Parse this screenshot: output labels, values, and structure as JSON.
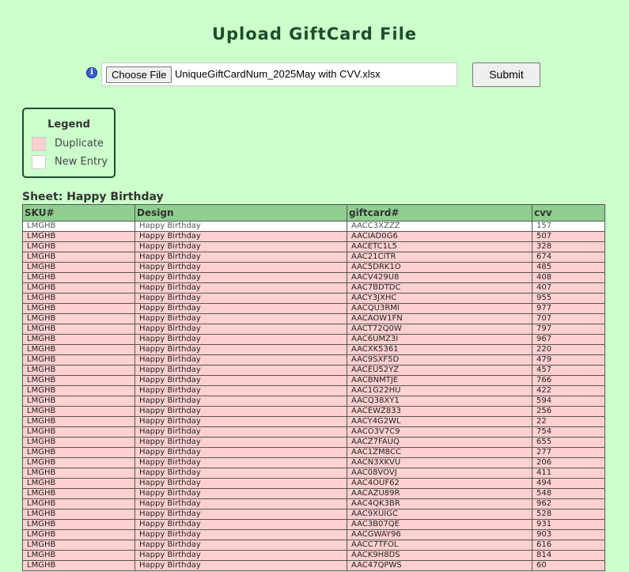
{
  "page": {
    "title": "Upload GiftCard File"
  },
  "upload": {
    "info_icon": "info-icon",
    "choose_label": "Choose File",
    "file_name": "UniqueGiftCardNum_2025May with CVV.xlsx",
    "submit_label": "Submit"
  },
  "legend": {
    "title": "Legend",
    "items": [
      {
        "label": "Duplicate",
        "color": "#ffd0d0"
      },
      {
        "label": "New Entry",
        "color": "#ffffff"
      }
    ]
  },
  "sheet": {
    "title": "Sheet: Happy Birthday",
    "columns": [
      "SKU#",
      "Design",
      "giftcard#",
      "cvv"
    ],
    "rows": [
      {
        "sku": "LMGHB",
        "design": "Happy Birthday",
        "giftcard": "AACC3XZZZ",
        "cvv": "157",
        "status": "new"
      },
      {
        "sku": "LMGHB",
        "design": "Happy Birthday",
        "giftcard": "AACIAD0G6",
        "cvv": "507",
        "status": "dup"
      },
      {
        "sku": "LMGHB",
        "design": "Happy Birthday",
        "giftcard": "AACETC1L5",
        "cvv": "328",
        "status": "dup"
      },
      {
        "sku": "LMGHB",
        "design": "Happy Birthday",
        "giftcard": "AAC21CITR",
        "cvv": "674",
        "status": "dup"
      },
      {
        "sku": "LMGHB",
        "design": "Happy Birthday",
        "giftcard": "AAC5DRK1O",
        "cvv": "485",
        "status": "dup"
      },
      {
        "sku": "LMGHB",
        "design": "Happy Birthday",
        "giftcard": "AACV429U8",
        "cvv": "408",
        "status": "dup"
      },
      {
        "sku": "LMGHB",
        "design": "Happy Birthday",
        "giftcard": "AAC7BDTDC",
        "cvv": "407",
        "status": "dup"
      },
      {
        "sku": "LMGHB",
        "design": "Happy Birthday",
        "giftcard": "AACY3JXHC",
        "cvv": "955",
        "status": "dup"
      },
      {
        "sku": "LMGHB",
        "design": "Happy Birthday",
        "giftcard": "AACQU3RMI",
        "cvv": "977",
        "status": "dup"
      },
      {
        "sku": "LMGHB",
        "design": "Happy Birthday",
        "giftcard": "AACAOW1FN",
        "cvv": "707",
        "status": "dup"
      },
      {
        "sku": "LMGHB",
        "design": "Happy Birthday",
        "giftcard": "AACT72Q0W",
        "cvv": "797",
        "status": "dup"
      },
      {
        "sku": "LMGHB",
        "design": "Happy Birthday",
        "giftcard": "AAC6UMZ3I",
        "cvv": "967",
        "status": "dup"
      },
      {
        "sku": "LMGHB",
        "design": "Happy Birthday",
        "giftcard": "AACXK5361",
        "cvv": "220",
        "status": "dup"
      },
      {
        "sku": "LMGHB",
        "design": "Happy Birthday",
        "giftcard": "AAC9SXF5D",
        "cvv": "479",
        "status": "dup"
      },
      {
        "sku": "LMGHB",
        "design": "Happy Birthday",
        "giftcard": "AACEU52YZ",
        "cvv": "457",
        "status": "dup"
      },
      {
        "sku": "LMGHB",
        "design": "Happy Birthday",
        "giftcard": "AACBNMTJE",
        "cvv": "766",
        "status": "dup"
      },
      {
        "sku": "LMGHB",
        "design": "Happy Birthday",
        "giftcard": "AAC1G22HU",
        "cvv": "422",
        "status": "dup"
      },
      {
        "sku": "LMGHB",
        "design": "Happy Birthday",
        "giftcard": "AACQ38XY1",
        "cvv": "594",
        "status": "dup"
      },
      {
        "sku": "LMGHB",
        "design": "Happy Birthday",
        "giftcard": "AACEWZ833",
        "cvv": "256",
        "status": "dup"
      },
      {
        "sku": "LMGHB",
        "design": "Happy Birthday",
        "giftcard": "AACY4G2WL",
        "cvv": "22",
        "status": "dup"
      },
      {
        "sku": "LMGHB",
        "design": "Happy Birthday",
        "giftcard": "AACO3V7C9",
        "cvv": "754",
        "status": "dup"
      },
      {
        "sku": "LMGHB",
        "design": "Happy Birthday",
        "giftcard": "AACZ7FAUQ",
        "cvv": "655",
        "status": "dup"
      },
      {
        "sku": "LMGHB",
        "design": "Happy Birthday",
        "giftcard": "AAC1ZM8CC",
        "cvv": "277",
        "status": "dup"
      },
      {
        "sku": "LMGHB",
        "design": "Happy Birthday",
        "giftcard": "AACN3XKVU",
        "cvv": "206",
        "status": "dup"
      },
      {
        "sku": "LMGHB",
        "design": "Happy Birthday",
        "giftcard": "AAC08VOVJ",
        "cvv": "411",
        "status": "dup"
      },
      {
        "sku": "LMGHB",
        "design": "Happy Birthday",
        "giftcard": "AAC4OUF62",
        "cvv": "494",
        "status": "dup"
      },
      {
        "sku": "LMGHB",
        "design": "Happy Birthday",
        "giftcard": "AACAZU89R",
        "cvv": "548",
        "status": "dup"
      },
      {
        "sku": "LMGHB",
        "design": "Happy Birthday",
        "giftcard": "AAC4QK3BR",
        "cvv": "962",
        "status": "dup"
      },
      {
        "sku": "LMGHB",
        "design": "Happy Birthday",
        "giftcard": "AAC9XUIGC",
        "cvv": "528",
        "status": "dup"
      },
      {
        "sku": "LMGHB",
        "design": "Happy Birthday",
        "giftcard": "AAC3B07QE",
        "cvv": "931",
        "status": "dup"
      },
      {
        "sku": "LMGHB",
        "design": "Happy Birthday",
        "giftcard": "AACGWAY96",
        "cvv": "903",
        "status": "dup"
      },
      {
        "sku": "LMGHB",
        "design": "Happy Birthday",
        "giftcard": "AACC7TFOL",
        "cvv": "616",
        "status": "dup"
      },
      {
        "sku": "LMGHB",
        "design": "Happy Birthday",
        "giftcard": "AACK9H8DS",
        "cvv": "814",
        "status": "dup"
      },
      {
        "sku": "LMGHB",
        "design": "Happy Birthday",
        "giftcard": "AAC47QPWS",
        "cvv": "60",
        "status": "dup"
      }
    ]
  }
}
